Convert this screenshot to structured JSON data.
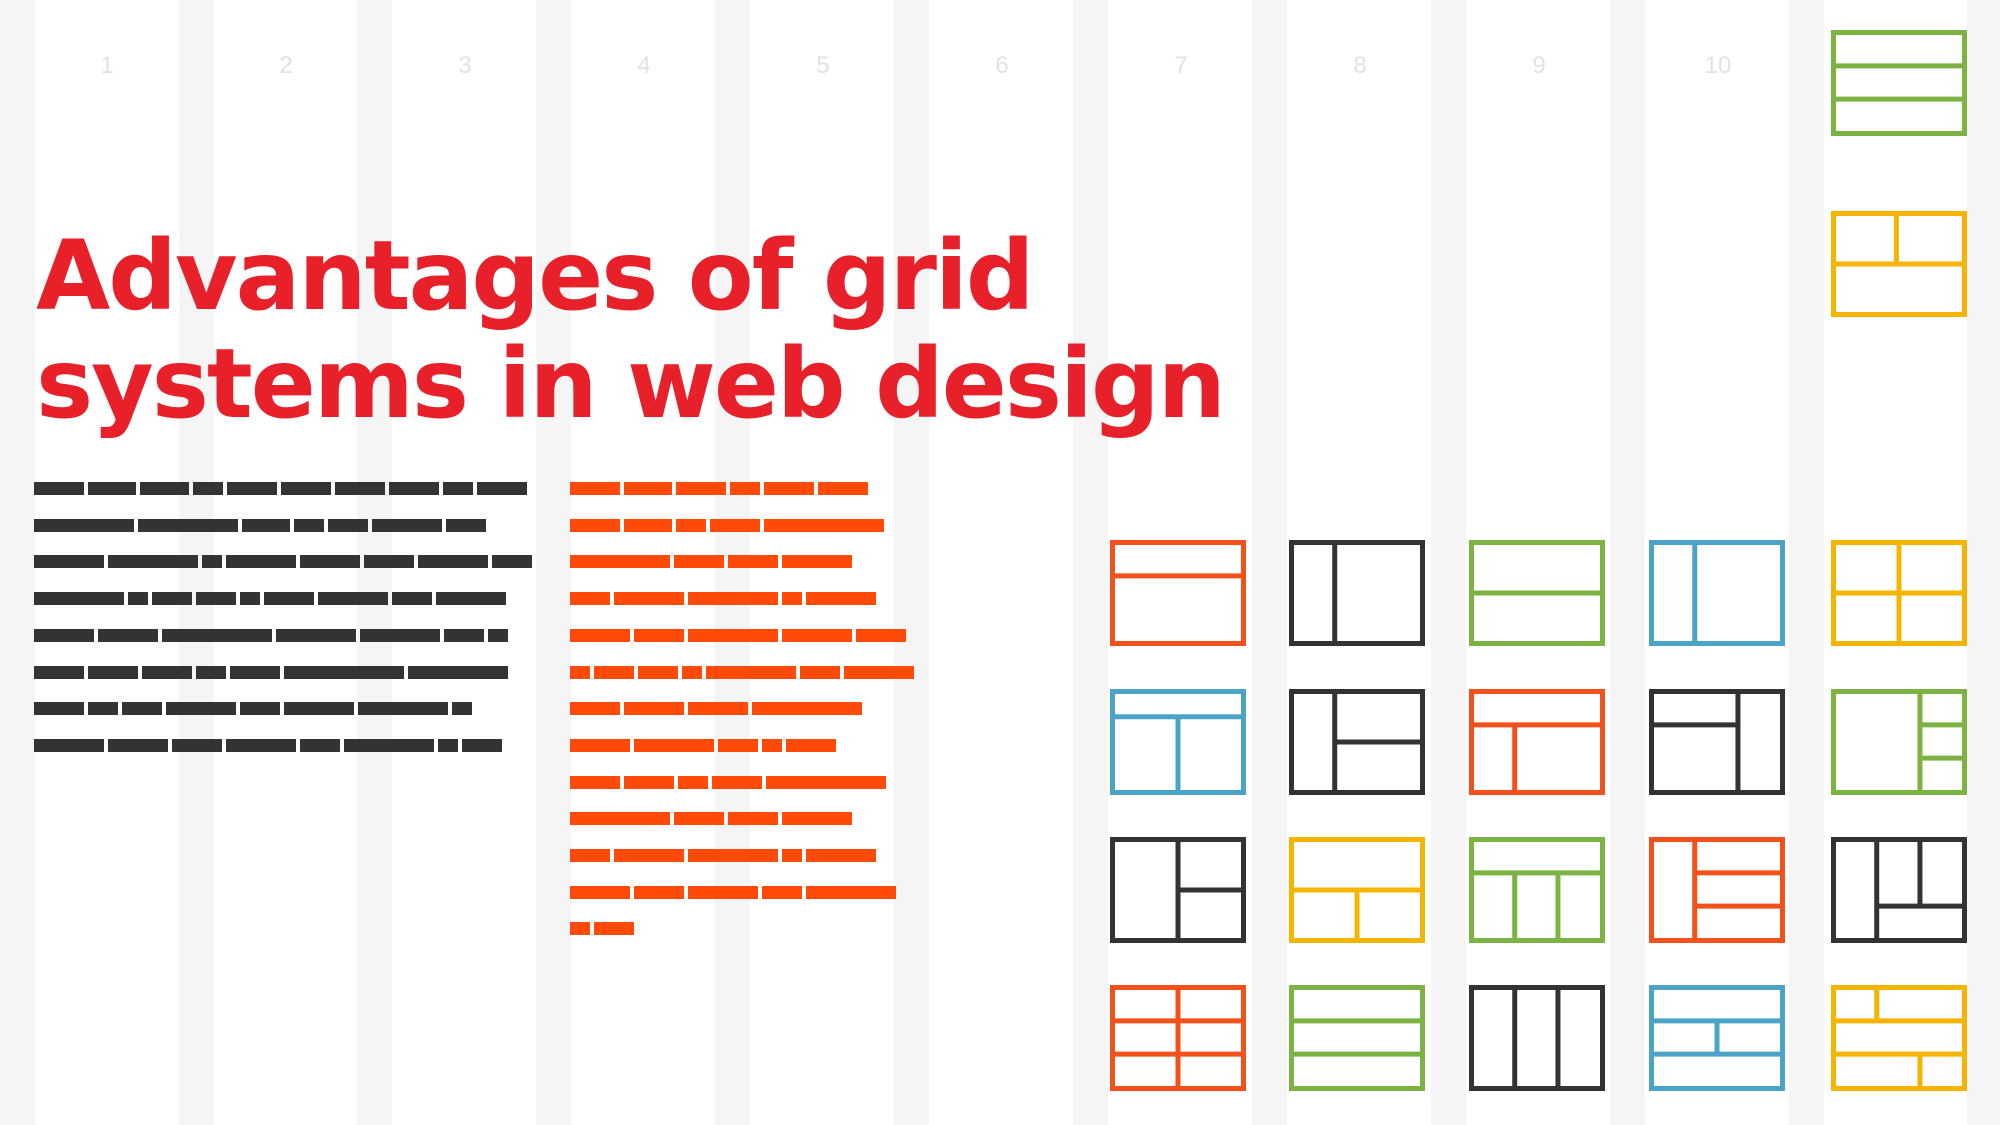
{
  "column_numbers": [
    "1",
    "2",
    "3",
    "4",
    "5",
    "6",
    "7",
    "8",
    "9",
    "10"
  ],
  "title": {
    "line1": "Advantages of grid",
    "line2": "systems in web design"
  },
  "colors": {
    "title_red": "#e8202a",
    "text_dark": "#333333",
    "text_orange": "#ff4a0a",
    "gutter": "#f5f5f5",
    "green": "#7cb342",
    "yellow": "#f4b400",
    "orange": "#f2511b",
    "blue": "#4ba3c7",
    "charcoal": "#333333"
  },
  "layout_icons": [
    {
      "name": "three-rows-layout-icon",
      "color": "green"
    },
    {
      "name": "split-top-layout-icon",
      "color": "yellow"
    },
    {
      "name": "header-body-layout-icon",
      "color": "orange"
    },
    {
      "name": "two-column-layout-icon",
      "color": "charcoal"
    },
    {
      "name": "two-rows-layout-icon",
      "color": "green"
    },
    {
      "name": "two-column-layout-icon",
      "color": "blue"
    },
    {
      "name": "quad-layout-icon",
      "color": "yellow"
    },
    {
      "name": "header-two-column-layout-icon",
      "color": "blue"
    },
    {
      "name": "sidebar-split-right-layout-icon",
      "color": "charcoal"
    },
    {
      "name": "header-sidebar-layout-icon",
      "color": "orange"
    },
    {
      "name": "split-left-sidebar-layout-icon",
      "color": "charcoal"
    },
    {
      "name": "right-sidebar-stack-layout-icon",
      "color": "green"
    },
    {
      "name": "left-split-right-layout-icon",
      "color": "charcoal"
    },
    {
      "name": "header-split-footer-layout-icon",
      "color": "yellow"
    },
    {
      "name": "header-three-column-layout-icon",
      "color": "green"
    },
    {
      "name": "sidebar-three-rows-layout-icon",
      "color": "orange"
    },
    {
      "name": "three-column-complex-layout-icon",
      "color": "charcoal"
    },
    {
      "name": "six-cell-layout-icon",
      "color": "orange"
    },
    {
      "name": "three-rows-layout-icon",
      "color": "green"
    },
    {
      "name": "three-column-layout-icon",
      "color": "charcoal"
    },
    {
      "name": "three-rows-split-layout-icon",
      "color": "blue"
    },
    {
      "name": "brick-layout-icon",
      "color": "yellow"
    }
  ]
}
